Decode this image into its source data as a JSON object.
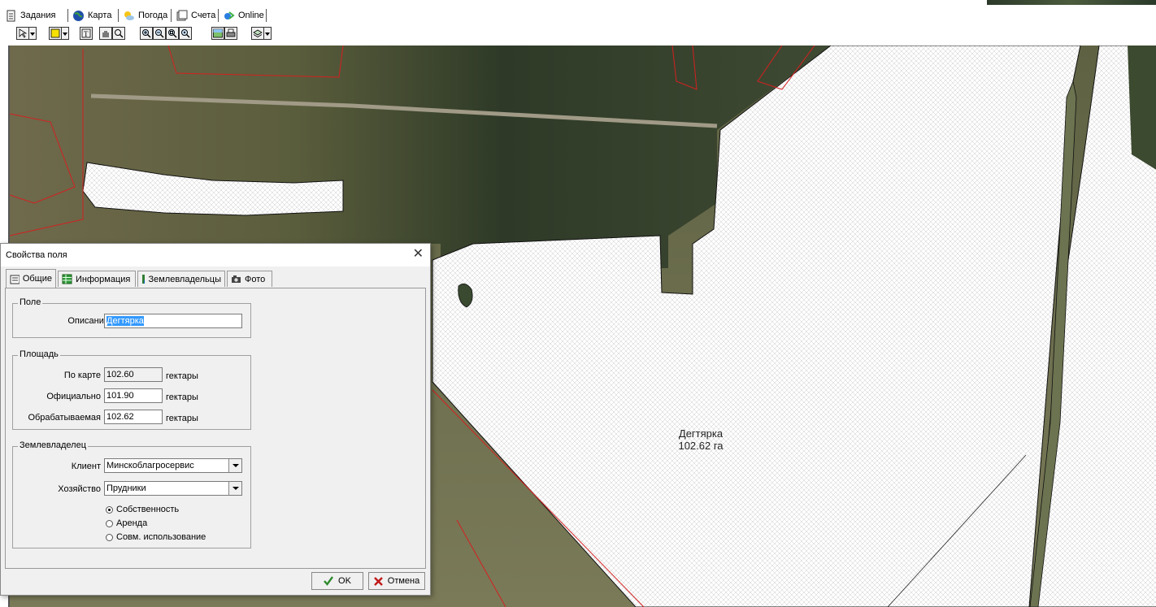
{
  "tabs": [
    {
      "label": "Задания",
      "icon": "document-icon"
    },
    {
      "label": "Карта",
      "icon": "globe-icon"
    },
    {
      "label": "Погода",
      "icon": "weather-icon"
    },
    {
      "label": "Счета",
      "icon": "invoice-icon"
    },
    {
      "label": "Online",
      "icon": "online-icon"
    }
  ],
  "toolbar": {
    "tools": [
      "select-tool-icon",
      "field-tool-icon",
      "text-tool-icon",
      "pan-tool-icon",
      "info-tool-icon",
      "zoom-in-icon",
      "zoom-out-icon",
      "zoom-area-icon",
      "zoom-extent-icon",
      "image-icon",
      "print-icon",
      "layers-icon"
    ]
  },
  "map": {
    "field_name": "Дегтярка",
    "field_area": "102.62 га"
  },
  "dialog": {
    "title": "Свойства поля",
    "close": "✕",
    "tabs": [
      "Общие",
      "Информация",
      "Землевладельцы",
      "Фото"
    ],
    "group_field": {
      "legend": "Поле",
      "description_label": "Описание",
      "description_value": "Дегтярка"
    },
    "group_area": {
      "legend": "Площадь",
      "map_label": "По карте",
      "map_value": "102.60",
      "official_label": "Официально",
      "official_value": "101.90",
      "worked_label": "Обрабатываемая",
      "worked_value": "102.62",
      "unit": "гектары"
    },
    "group_owner": {
      "legend": "Землевладелец",
      "client_label": "Клиент",
      "client_value": "Минскоблагросервис",
      "farm_label": "Хозяйство",
      "farm_value": "Прудники",
      "options": [
        "Собственность",
        "Аренда",
        "Совм. использование"
      ],
      "selected_option": "Собственность"
    },
    "ok_label": "OK",
    "cancel_label": "Отмена"
  },
  "colors": {
    "selection": "#3399ff",
    "field_outline": "#111111",
    "parcel_lines": "#d42020",
    "ok_check": "#2e8b2e",
    "cancel_x": "#c01818"
  }
}
